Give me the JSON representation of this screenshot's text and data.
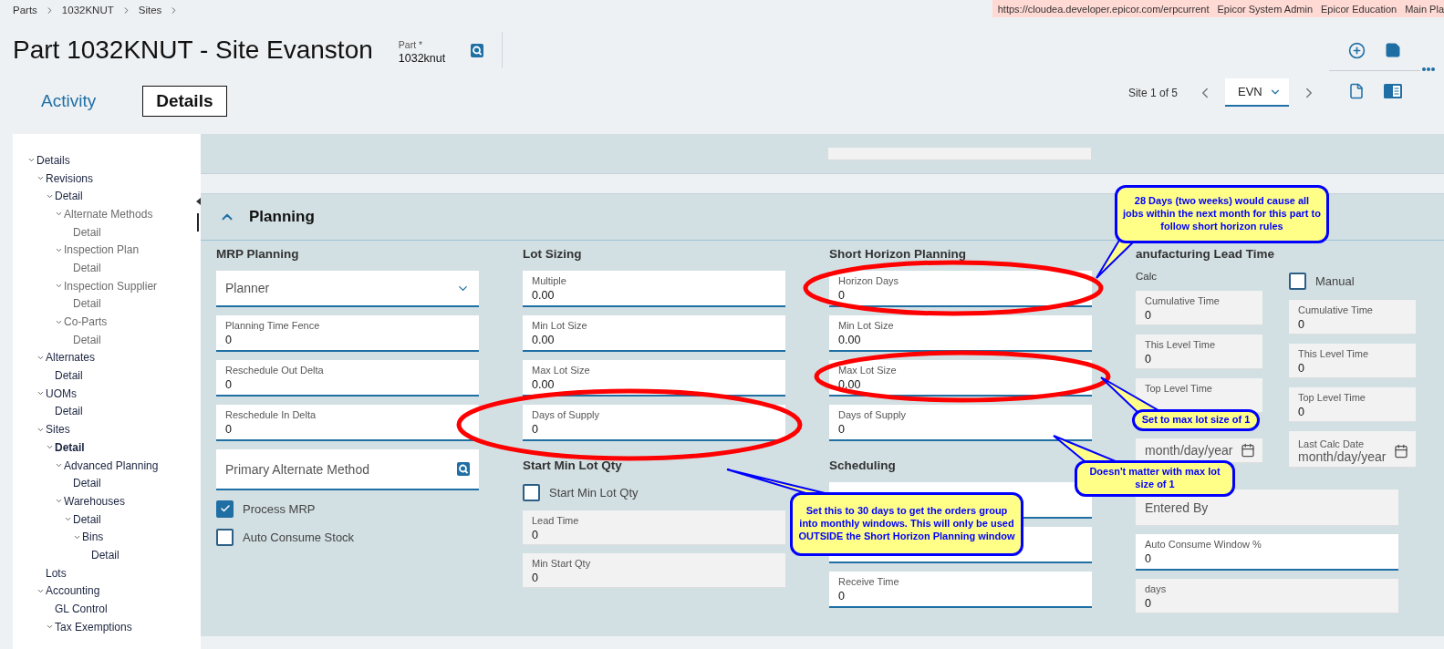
{
  "breadcrumbs": [
    "Parts",
    "1032KNUT",
    "Sites"
  ],
  "environment_bar": [
    "https://cloudea.developer.epicor.com/erpcurrent",
    "Epicor System Admin",
    "Epicor Education",
    "Main Pla"
  ],
  "title": "Part 1032KNUT - Site Evanston",
  "part_field": {
    "label": "Part *",
    "value": "1032knut"
  },
  "tabs": [
    {
      "label": "Activity",
      "selected": false
    },
    {
      "label": "Details",
      "selected": true
    }
  ],
  "site_nav": {
    "position": "Site 1 of 5",
    "site": "EVN"
  },
  "tree": [
    {
      "label": "Details",
      "expanded": true,
      "selected": false,
      "disabled": false,
      "children": [
        {
          "label": "Revisions",
          "expanded": true,
          "selected": false,
          "disabled": false,
          "children": [
            {
              "label": "Detail",
              "expanded": true,
              "selected": false,
              "disabled": false,
              "children": [
                {
                  "label": "Alternate Methods",
                  "expanded": true,
                  "selected": false,
                  "disabled": true,
                  "children": [
                    {
                      "label": "Detail",
                      "selected": false,
                      "disabled": true
                    }
                  ]
                },
                {
                  "label": "Inspection Plan",
                  "expanded": true,
                  "selected": false,
                  "disabled": true,
                  "children": [
                    {
                      "label": "Detail",
                      "selected": false,
                      "disabled": true
                    }
                  ]
                },
                {
                  "label": "Inspection Supplier",
                  "expanded": true,
                  "selected": false,
                  "disabled": true,
                  "children": [
                    {
                      "label": "Detail",
                      "selected": false,
                      "disabled": true
                    }
                  ]
                },
                {
                  "label": "Co-Parts",
                  "expanded": true,
                  "selected": false,
                  "disabled": true,
                  "children": [
                    {
                      "label": "Detail",
                      "selected": false,
                      "disabled": true
                    }
                  ]
                }
              ]
            }
          ]
        },
        {
          "label": "Alternates",
          "expanded": true,
          "selected": false,
          "disabled": false,
          "children": [
            {
              "label": "Detail",
              "selected": false,
              "disabled": false
            }
          ]
        },
        {
          "label": "UOMs",
          "expanded": true,
          "selected": false,
          "disabled": false,
          "children": [
            {
              "label": "Detail",
              "selected": false,
              "disabled": false
            }
          ]
        },
        {
          "label": "Sites",
          "expanded": true,
          "selected": false,
          "disabled": false,
          "children": [
            {
              "label": "Detail",
              "expanded": true,
              "selected": true,
              "disabled": false,
              "children": [
                {
                  "label": "Advanced Planning",
                  "expanded": true,
                  "selected": false,
                  "disabled": false,
                  "children": [
                    {
                      "label": "Detail",
                      "selected": false,
                      "disabled": false
                    }
                  ]
                },
                {
                  "label": "Warehouses",
                  "expanded": true,
                  "selected": false,
                  "disabled": false,
                  "children": [
                    {
                      "label": "Detail",
                      "expanded": true,
                      "selected": false,
                      "disabled": false,
                      "children": [
                        {
                          "label": "Bins",
                          "expanded": true,
                          "selected": false,
                          "disabled": false,
                          "children": [
                            {
                              "label": "Detail",
                              "selected": false,
                              "disabled": false
                            }
                          ]
                        }
                      ]
                    }
                  ]
                }
              ]
            }
          ]
        },
        {
          "label": "Lots",
          "selected": false,
          "disabled": false
        },
        {
          "label": "Accounting",
          "expanded": true,
          "selected": false,
          "disabled": false,
          "children": [
            {
              "label": "GL Control",
              "selected": false,
              "disabled": false
            },
            {
              "label": "Tax Exemptions",
              "expanded": true,
              "selected": false,
              "disabled": false
            }
          ]
        }
      ]
    }
  ],
  "section": {
    "title": "Planning",
    "expanded": true,
    "columns": [
      {
        "items": [
          {
            "kind": "heading",
            "text": "MRP Planning"
          },
          {
            "kind": "select",
            "placeholder": "Planner"
          },
          {
            "kind": "input",
            "label": "Planning Time Fence",
            "value": "0"
          },
          {
            "kind": "input",
            "label": "Reschedule Out Delta",
            "value": "0"
          },
          {
            "kind": "input",
            "label": "Reschedule In Delta",
            "value": "0"
          },
          {
            "kind": "lookup",
            "placeholder": "Primary Alternate Method"
          },
          {
            "kind": "checkbox",
            "label": "Process MRP",
            "checked": true
          },
          {
            "kind": "checkbox",
            "label": "Auto Consume Stock",
            "checked": false
          }
        ]
      },
      {
        "items": [
          {
            "kind": "heading",
            "text": "Lot Sizing"
          },
          {
            "kind": "input",
            "label": "Multiple",
            "value": "0.00"
          },
          {
            "kind": "input",
            "label": "Min Lot Size",
            "value": "0.00"
          },
          {
            "kind": "input",
            "label": "Max Lot Size",
            "value": "0.00"
          },
          {
            "kind": "input",
            "label": "Days of Supply",
            "value": "0"
          },
          {
            "kind": "heading",
            "text": "Start Min Lot Qty"
          },
          {
            "kind": "checkbox",
            "label": "Start Min Lot Qty",
            "checked": false
          },
          {
            "kind": "readonly",
            "label": "Lead Time",
            "value": "0"
          },
          {
            "kind": "readonly",
            "label": "Min Start Qty",
            "value": "0"
          }
        ]
      },
      {
        "items": [
          {
            "kind": "heading",
            "text": "Short Horizon Planning"
          },
          {
            "kind": "input",
            "label": "Horizon Days",
            "value": "0"
          },
          {
            "kind": "input",
            "label": "Min Lot Size",
            "value": "0.00"
          },
          {
            "kind": "input",
            "label": "Max Lot Size",
            "value": "0.00"
          },
          {
            "kind": "input",
            "label": "Days of Supply",
            "value": "0"
          },
          {
            "kind": "heading",
            "text": "Scheduling"
          },
          {
            "kind": "covered"
          },
          {
            "kind": "covered"
          },
          {
            "kind": "input",
            "label": "Receive Time",
            "value": "0"
          }
        ]
      },
      {
        "heading": "anufacturing Lead Time",
        "subcolumns": [
          {
            "items": [
              {
                "kind": "caption",
                "text": "Calc"
              },
              {
                "kind": "readonly",
                "label": "Cumulative Time",
                "value": "0"
              },
              {
                "kind": "readonly",
                "label": "This Level Time",
                "value": "0"
              },
              {
                "kind": "readonly",
                "label": "Top Level Time"
              },
              {
                "kind": "date",
                "placeholder": "month/day/year"
              }
            ]
          },
          {
            "items": [
              {
                "kind": "checkbox",
                "label": "Manual",
                "checked": false
              },
              {
                "kind": "readonly",
                "label": "Cumulative Time",
                "value": "0"
              },
              {
                "kind": "readonly",
                "label": "This Level Time",
                "value": "0"
              },
              {
                "kind": "readonly",
                "label": "Top Level Time",
                "value": "0"
              },
              {
                "kind": "date",
                "label": "Last Calc Date",
                "placeholder": "month/day/year"
              }
            ]
          }
        ],
        "items": [
          {
            "kind": "readonly",
            "placeholder": "Entered By"
          },
          {
            "kind": "input",
            "label": "Auto Consume Window %",
            "value": "0"
          },
          {
            "kind": "readonly",
            "label": "days",
            "value": "0"
          }
        ]
      }
    ]
  },
  "annotations": [
    {
      "text": "28 Days (two weeks) would cause all jobs within the next month for this part to follow short horizon rules"
    },
    {
      "text": "Set to max lot size of 1"
    },
    {
      "text": "Doesn't matter with max lot size of 1"
    },
    {
      "text": "Set this to 30 days to get the orders group into monthly windows. This will only be used OUTSIDE the Short Horizon Planning window"
    }
  ]
}
